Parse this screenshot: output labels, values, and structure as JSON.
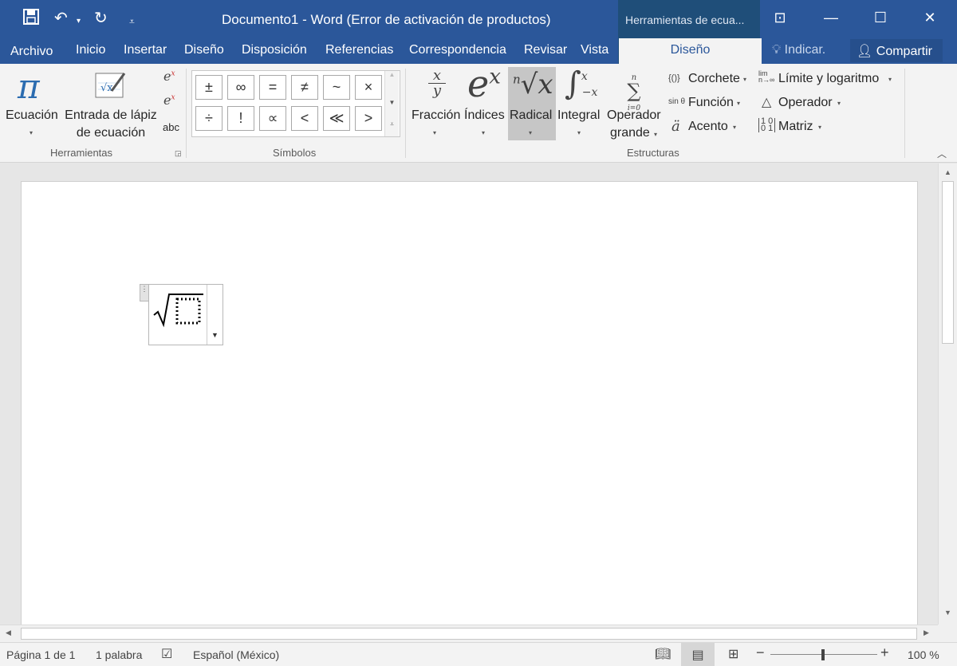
{
  "window": {
    "title": "Documento1 - Word (Error de activación de productos)",
    "context_tab_title": "Herramientas de ecua...",
    "quick_access": {
      "save_icon": "save-icon",
      "undo_icon": "undo-icon",
      "redo_icon": "redo-icon"
    },
    "controls": {
      "ribbon_display": "⊡",
      "minimize": "—",
      "maximize": "☐",
      "close": "✕"
    }
  },
  "menu": {
    "tabs": [
      "Archivo",
      "Inicio",
      "Insertar",
      "Diseño",
      "Disposición",
      "Referencias",
      "Correspondencia",
      "Revisar",
      "Vista"
    ],
    "context_tab": "Diseño",
    "tell_me": "Indicar.",
    "share": "Compartir"
  },
  "ribbon": {
    "herramientas": {
      "label": "Herramientas",
      "ecuacion": "Ecuación",
      "ink_line1": "Entrada de lápiz",
      "ink_line2": "de ecuación",
      "abc": "abc"
    },
    "simbolos": {
      "label": "Símbolos",
      "row1": [
        "±",
        "∞",
        "=",
        "≠",
        "~",
        "×"
      ],
      "row2": [
        "÷",
        "!",
        "∝",
        "<",
        "≪",
        ">"
      ]
    },
    "estructuras": {
      "label": "Estructuras",
      "fraccion": "Fracción",
      "indices": "Índices",
      "radical": "Radical",
      "integral": "Integral",
      "operador_line1": "Operador",
      "operador_line2": "grande",
      "corchete": "Corchete",
      "funcion": "Función",
      "acento": "Acento",
      "limite": "Límite y logaritmo",
      "operador": "Operador",
      "matriz": "Matriz"
    }
  },
  "status": {
    "page": "Página 1 de 1",
    "words": "1 palabra",
    "language": "Español (México)",
    "zoom": "100 %"
  }
}
